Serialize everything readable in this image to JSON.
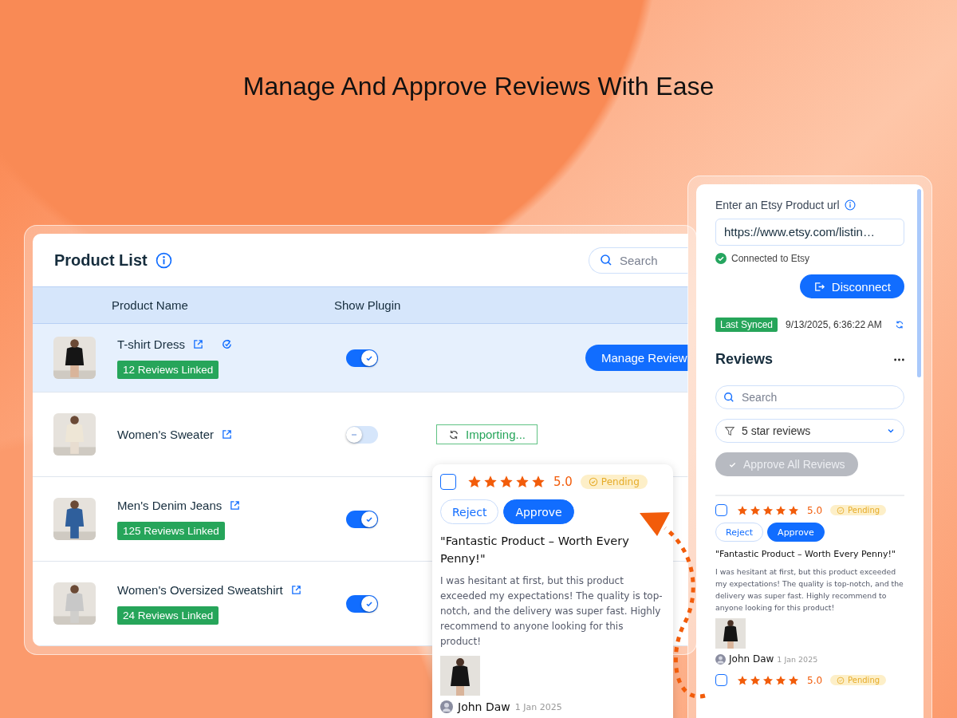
{
  "heading": "Manage And Approve Reviews With Ease",
  "product_list": {
    "title": "Product List",
    "search": {
      "placeholder": "Search"
    },
    "columns": [
      "Product Name",
      "Show Plugin"
    ],
    "rows": [
      {
        "name": "T-shirt Dress",
        "selected": true,
        "auto_sync": true,
        "show_plugin": true,
        "badge": "12 Reviews Linked",
        "action": {
          "kind": "button",
          "label": "Manage Review"
        }
      },
      {
        "name": "Women's Sweater",
        "selected": false,
        "auto_sync": false,
        "show_plugin": false,
        "action": {
          "kind": "status",
          "label": "Importing..."
        }
      },
      {
        "name": "Men's Denim Jeans",
        "selected": false,
        "auto_sync": false,
        "show_plugin": true,
        "badge": "125 Reviews Linked"
      },
      {
        "name": "Women's Oversized Sweatshirt",
        "selected": false,
        "auto_sync": false,
        "show_plugin": true,
        "badge": "24 Reviews Linked"
      }
    ]
  },
  "review_popup": {
    "checked": false,
    "stars": 5,
    "rating": "5.0",
    "status": "Pending",
    "buttons": [
      "Reject",
      "Approve"
    ],
    "title": "\"Fantastic Product – Worth Every Penny!\"",
    "body": "I was hesitant at first, but this product exceeded my expectations! The quality is top-notch, and the delivery was super fast. Highly recommend to anyone looking for this product!",
    "author": "John Daw",
    "date": "1 Jan 2025"
  },
  "etsy_panel": {
    "url_label": "Enter an Etsy Product url",
    "url": "https://www.etsy.com/listin…",
    "connected": true,
    "connection": "Connected to Etsy",
    "disconnect": "Disconnect",
    "sync_label": "Last Synced",
    "sync_time": "9/13/2025, 6:36:22 AM",
    "reviews_title": "Reviews",
    "search": {
      "placeholder": "Search"
    },
    "filter": "5 star reviews",
    "approve_all": {
      "label": "Approve All Reviews",
      "disabled": true
    },
    "reviews": [
      {
        "checked": false,
        "stars": 5,
        "rating": "5.0",
        "status": "Pending",
        "buttons": [
          "Reject",
          "Approve"
        ],
        "title": "\"Fantastic Product – Worth Every Penny!\"",
        "body": "I was hesitant at first, but this product exceeded my expectations! The quality is top-notch, and the delivery was super fast. Highly recommend to anyone looking for this product!",
        "author": "John Daw",
        "date": "1 Jan 2025"
      },
      {
        "checked": false,
        "stars": 5,
        "rating": "5.0",
        "status": "Pending"
      }
    ]
  }
}
